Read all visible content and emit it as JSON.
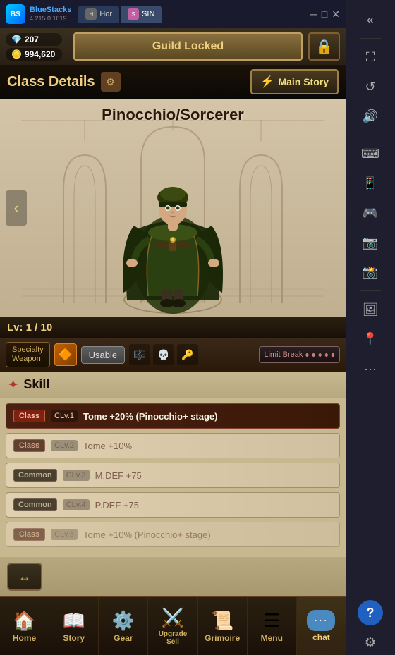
{
  "bluestacks": {
    "title": "BlueStacks",
    "version": "4.215.0.1019",
    "tabs": [
      {
        "label": "Hor",
        "active": false
      },
      {
        "label": "SIN",
        "active": true
      }
    ]
  },
  "status": {
    "currency1": "207",
    "currency2": "994,620",
    "guild_label": "Guild Locked"
  },
  "header": {
    "class_details": "Class Details",
    "main_story": "Main Story"
  },
  "character": {
    "name": "Pinocchio/Sorcerer",
    "level": "Lv: 1 / 10"
  },
  "action_bar": {
    "specialty_weapon": "Specialty\nWeapon",
    "usable": "Usable",
    "limit_break": "Limit Break",
    "diamonds": [
      "♦",
      "♦",
      "♦",
      "♦",
      "♦"
    ]
  },
  "skills": {
    "section_title": "Skill",
    "rows": [
      {
        "type": "Class",
        "type_style": "active",
        "level": "CLv.1",
        "desc": "Tome +20% (Pinocchio+ stage)",
        "active": true
      },
      {
        "type": "Class",
        "type_style": "dim",
        "level": "CLv.2",
        "desc": "Tome +10%",
        "active": false
      },
      {
        "type": "Common",
        "type_style": "dim",
        "level": "CLv.3",
        "desc": "M.DEF +75",
        "active": false
      },
      {
        "type": "Common",
        "type_style": "dim",
        "level": "CLv.4",
        "desc": "P.DEF +75",
        "active": false
      },
      {
        "type": "Class",
        "type_style": "dim",
        "level": "CLv.5",
        "desc": "Tome +10% (Pinocchio+ stage)",
        "active": false
      }
    ]
  },
  "bottom_nav": {
    "items": [
      {
        "icon": "🏠",
        "label": "Home",
        "active": false
      },
      {
        "icon": "📖",
        "label": "Story",
        "active": false
      },
      {
        "icon": "⚙️",
        "label": "Gear",
        "active": false
      },
      {
        "icon": "⚔️",
        "label": "Upgrade\nSell",
        "active": false
      },
      {
        "icon": "📜",
        "label": "Grimoire",
        "active": false
      },
      {
        "icon": "☰",
        "label": "Menu",
        "active": false
      },
      {
        "icon": "💬",
        "label": "chat",
        "active": true
      }
    ]
  }
}
